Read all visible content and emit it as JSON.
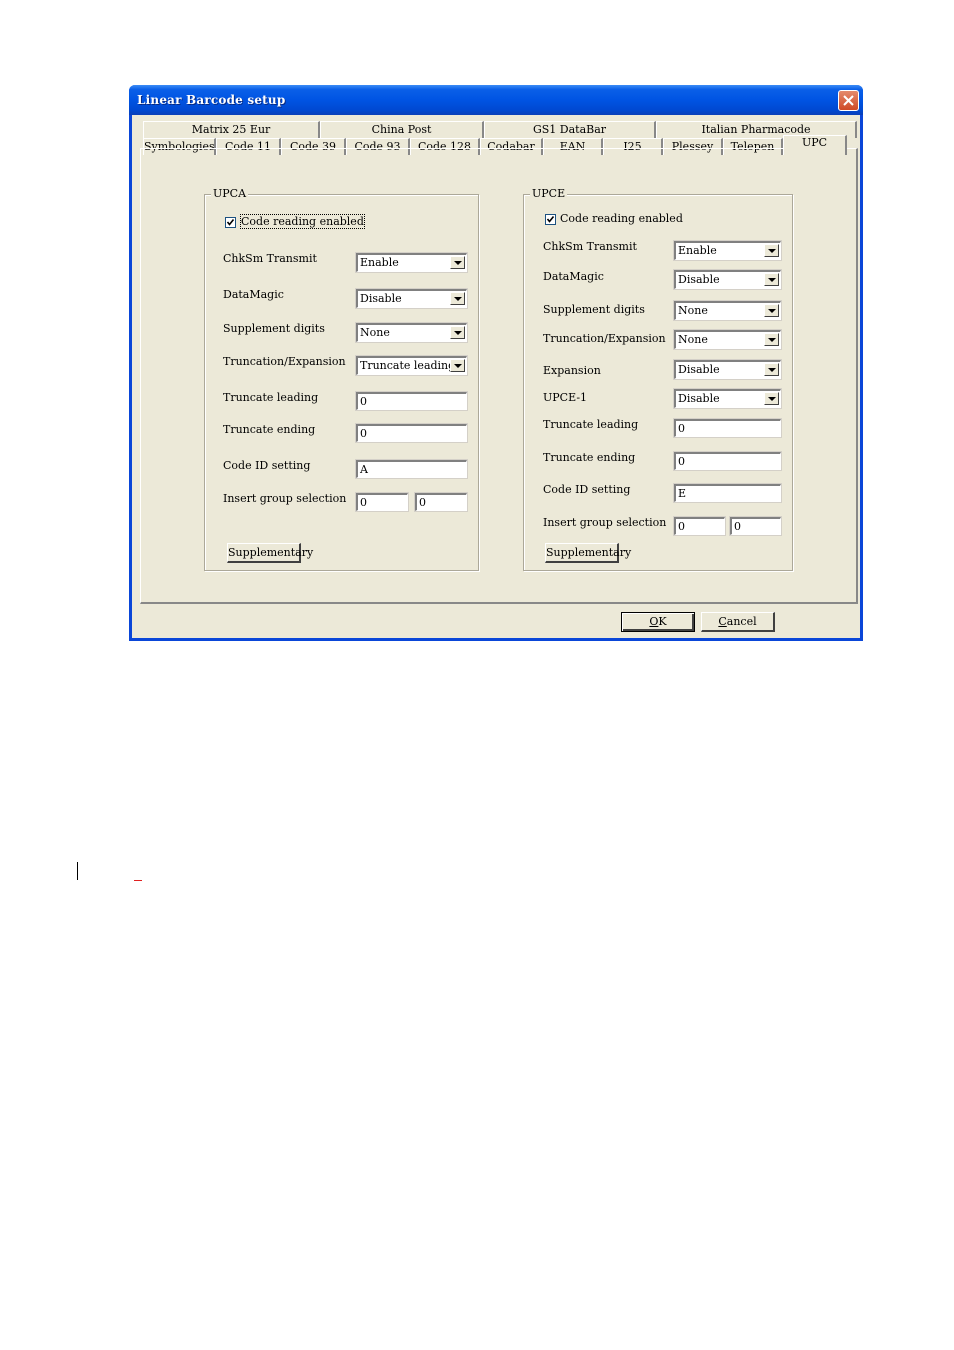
{
  "window": {
    "title": "Linear Barcode setup",
    "close_icon": "close-x-icon"
  },
  "tabs": {
    "back_row": [
      "Matrix 25 Eur",
      "China Post",
      "GS1 DataBar",
      "Italian Pharmacode"
    ],
    "front_row": [
      "Symbologies",
      "Code 11",
      "Code 39",
      "Code 93",
      "Code 128",
      "Codabar",
      "EAN",
      "I25",
      "Plessey",
      "Telepen",
      "UPC"
    ],
    "active": "UPC"
  },
  "upca": {
    "group_label": "UPCA",
    "code_reading": {
      "label": "Code reading enabled",
      "checked": true
    },
    "chksm_transmit": {
      "label": "ChkSm Transmit",
      "value": "Enable"
    },
    "datamagic": {
      "label": "DataMagic",
      "value": "Disable"
    },
    "supplement_digits": {
      "label": "Supplement digits",
      "value": "None"
    },
    "truncation_expansion": {
      "label": "Truncation/Expansion",
      "value": "Truncate leading ze:"
    },
    "truncate_leading": {
      "label": "Truncate leading",
      "value": "0"
    },
    "truncate_ending": {
      "label": "Truncate ending",
      "value": "0"
    },
    "code_id_setting": {
      "label": "Code ID setting",
      "value": "A"
    },
    "insert_group_selection": {
      "label": "Insert group selection",
      "value1": "0",
      "value2": "0"
    },
    "supplementary_button": "Supplementary"
  },
  "upce": {
    "group_label": "UPCE",
    "code_reading": {
      "label": "Code reading enabled",
      "checked": true
    },
    "chksm_transmit": {
      "label": "ChkSm Transmit",
      "value": "Enable"
    },
    "datamagic": {
      "label": "DataMagic",
      "value": "Disable"
    },
    "supplement_digits": {
      "label": "Supplement digits",
      "value": "None"
    },
    "truncation_expansion": {
      "label": "Truncation/Expansion",
      "value": "None"
    },
    "expansion": {
      "label": "Expansion",
      "value": "Disable"
    },
    "upce1": {
      "label": "UPCE-1",
      "value": "Disable"
    },
    "truncate_leading": {
      "label": "Truncate leading",
      "value": "0"
    },
    "truncate_ending": {
      "label": "Truncate ending",
      "value": "0"
    },
    "code_id_setting": {
      "label": "Code ID setting",
      "value": "E"
    },
    "insert_group_selection": {
      "label": "Insert group selection",
      "value1": "0",
      "value2": "0"
    },
    "supplementary_button": "Supplementary"
  },
  "footer": {
    "ok_mnemonic": "O",
    "ok_rest": "K",
    "cancel_mnemonic": "C",
    "cancel_rest": "ancel"
  }
}
